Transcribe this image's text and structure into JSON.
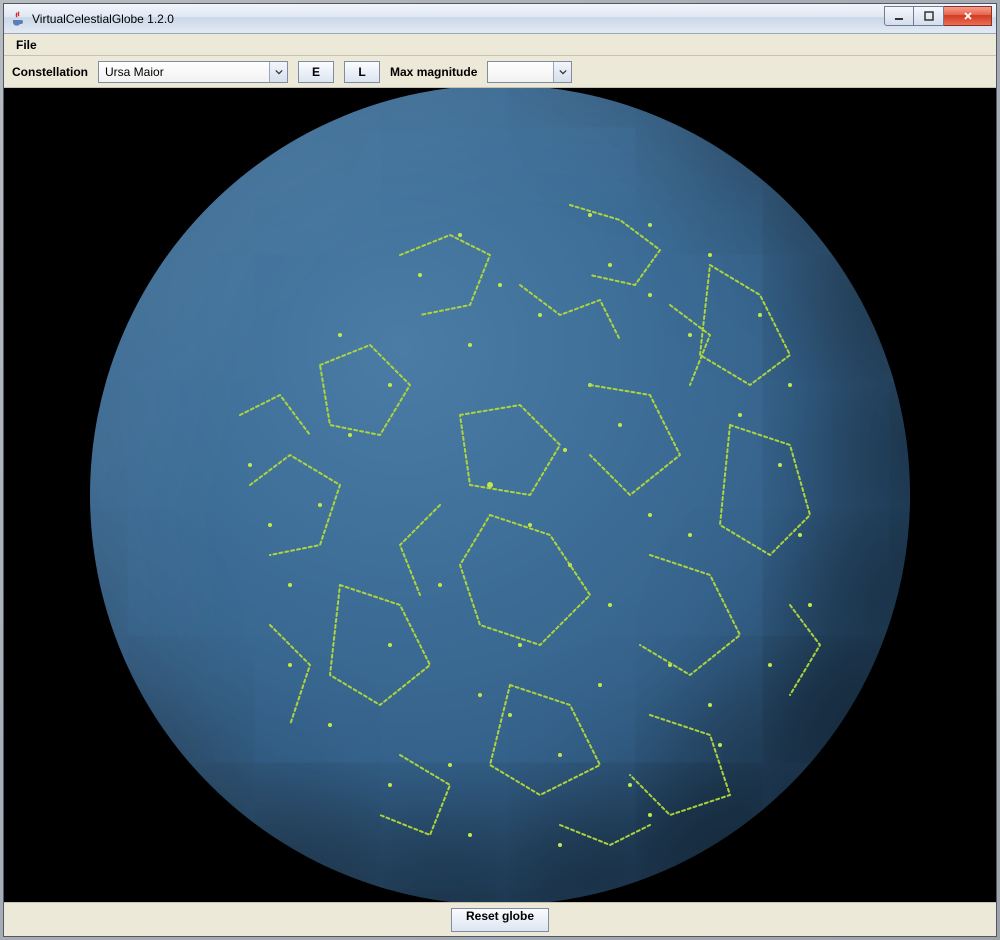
{
  "window": {
    "title": "VirtualCelestialGlobe 1.2.0"
  },
  "menubar": {
    "file": "File"
  },
  "toolbar": {
    "constellation_label": "Constellation",
    "constellation_value": "Ursa Maior",
    "button_e": "E",
    "button_l": "L",
    "max_magnitude_label": "Max magnitude",
    "max_magnitude_value": ""
  },
  "footer": {
    "reset_label": "Reset globe"
  },
  "icons": {
    "app": "java-cup-icon",
    "minimize": "minimize-icon",
    "maximize": "maximize-icon",
    "close": "close-icon",
    "dropdown": "chevron-down-icon"
  }
}
